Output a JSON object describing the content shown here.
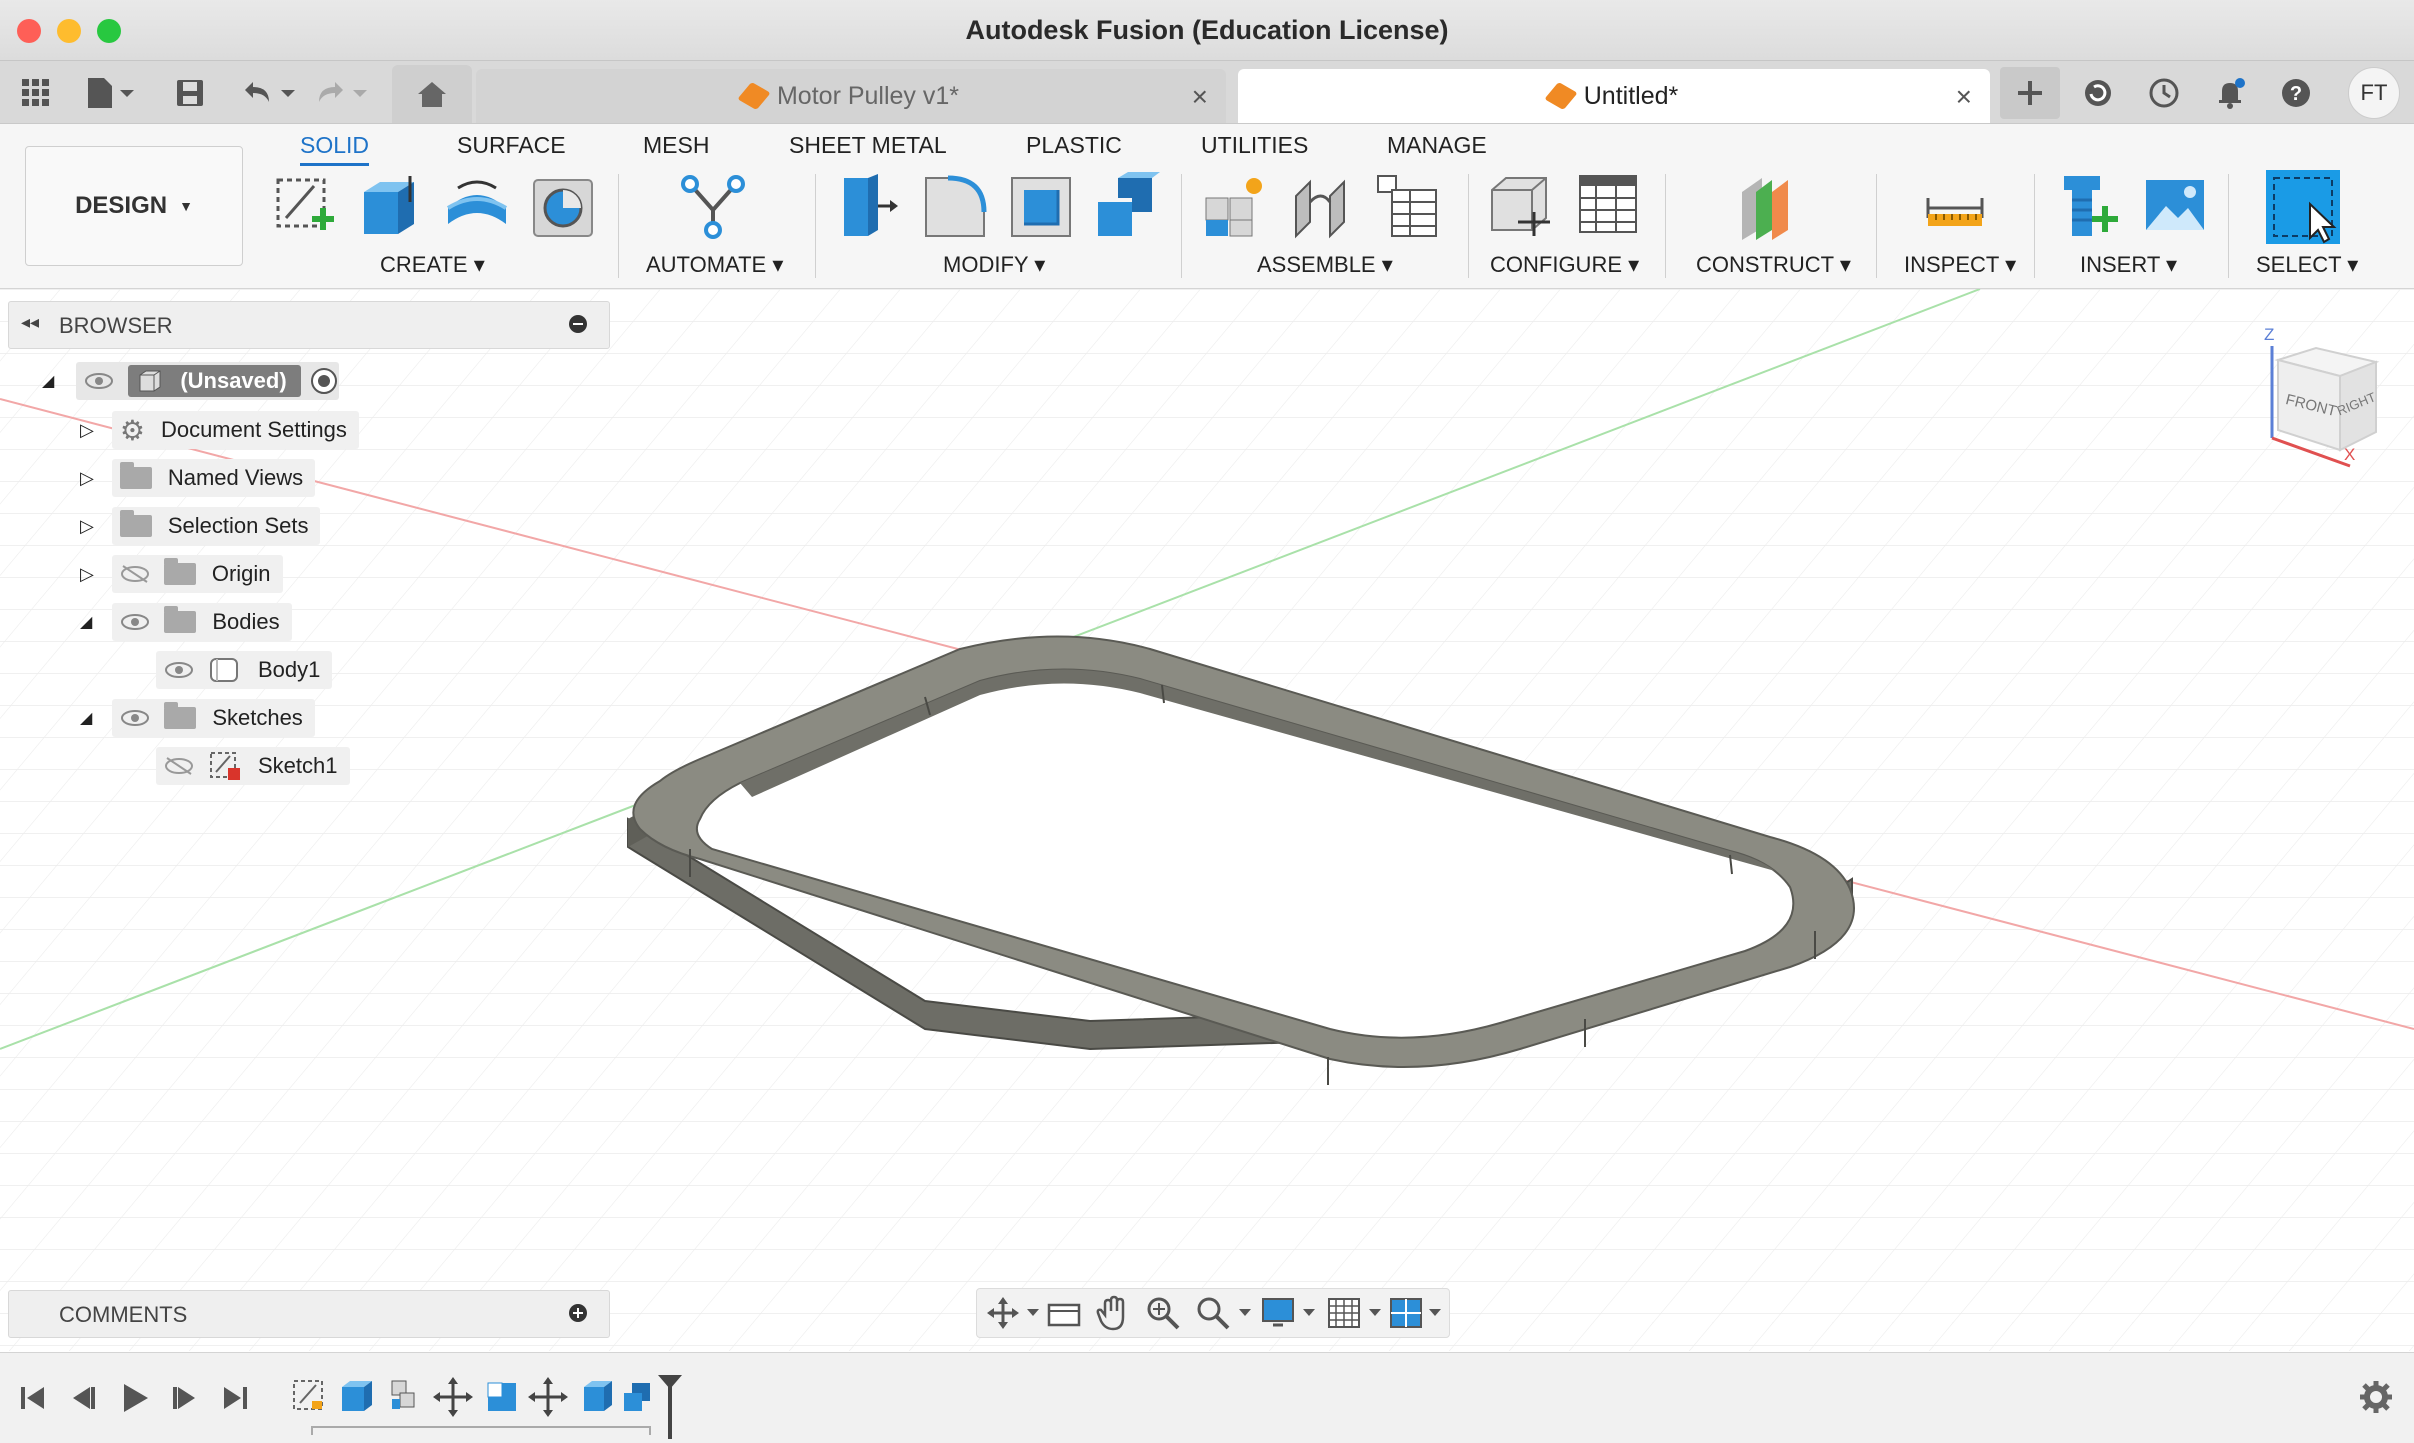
{
  "window": {
    "title": "Autodesk Fusion (Education License)"
  },
  "tabs": [
    {
      "label": "Motor Pulley v1*",
      "active": false
    },
    {
      "label": "Untitled*",
      "active": true
    }
  ],
  "user": {
    "initials": "FT"
  },
  "workspace": {
    "label": "DESIGN"
  },
  "ribbon_tabs": [
    "SOLID",
    "SURFACE",
    "MESH",
    "SHEET METAL",
    "PLASTIC",
    "UTILITIES",
    "MANAGE"
  ],
  "groups": {
    "create": "CREATE",
    "automate": "AUTOMATE",
    "modify": "MODIFY",
    "assemble": "ASSEMBLE",
    "configure": "CONFIGURE",
    "construct": "CONSTRUCT",
    "inspect": "INSPECT",
    "insert": "INSERT",
    "select": "SELECT"
  },
  "browser": {
    "title": "BROWSER",
    "root": "(Unsaved)",
    "items": [
      "Document Settings",
      "Named Views",
      "Selection Sets",
      "Origin",
      "Bodies",
      "Body1",
      "Sketches",
      "Sketch1"
    ]
  },
  "comments": {
    "title": "COMMENTS"
  },
  "viewcube": {
    "front": "FRONT",
    "right": "RIGHT",
    "z": "Z",
    "x": "X"
  },
  "colors": {
    "accent": "#1e73c8",
    "body": "#7b7b72",
    "select": "#1a9be6"
  }
}
